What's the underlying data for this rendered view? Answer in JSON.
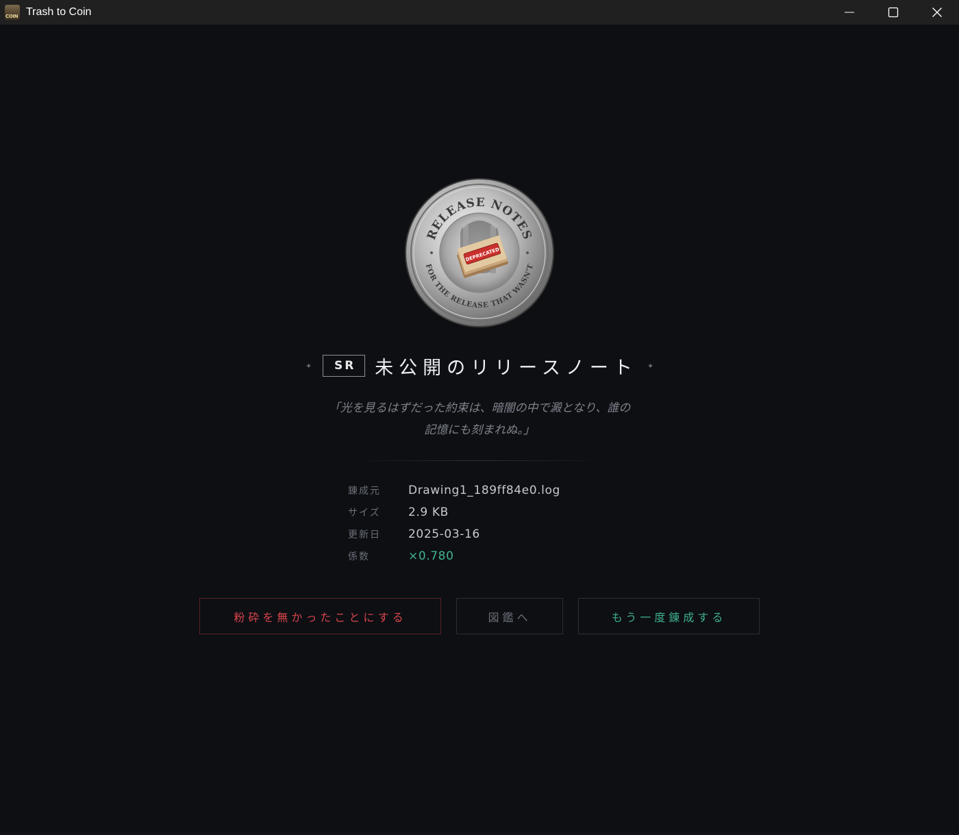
{
  "window": {
    "title": "Trash to Coin"
  },
  "coin": {
    "top_text": "RELEASE NOTES",
    "bottom_text": "FOR THE RELEASE THAT WASN'T",
    "stamp_text": "DEPRECATED"
  },
  "result": {
    "rarity": "SR",
    "name": "未公開のリリースノート",
    "flavor_line1": "「光を見るはずだった約束は、暗闇の中で澱となり、誰の",
    "flavor_line2": "記憶にも刻まれぬ。」"
  },
  "info": [
    {
      "label": "錬成元",
      "value": "Drawing1_189ff84e0.log"
    },
    {
      "label": "サイズ",
      "value": "2.9 KB"
    },
    {
      "label": "更新日",
      "value": "2025-03-16"
    },
    {
      "label": "係数",
      "value": "×0.780"
    }
  ],
  "buttons": {
    "undo": "粉砕を無かったことにする",
    "dex": "図鑑へ",
    "again": "もう一度錬成する"
  },
  "colors": {
    "background": "#0d0f13",
    "titlebar": "#202020",
    "danger": "#d9454d",
    "accent": "#41b48f"
  }
}
